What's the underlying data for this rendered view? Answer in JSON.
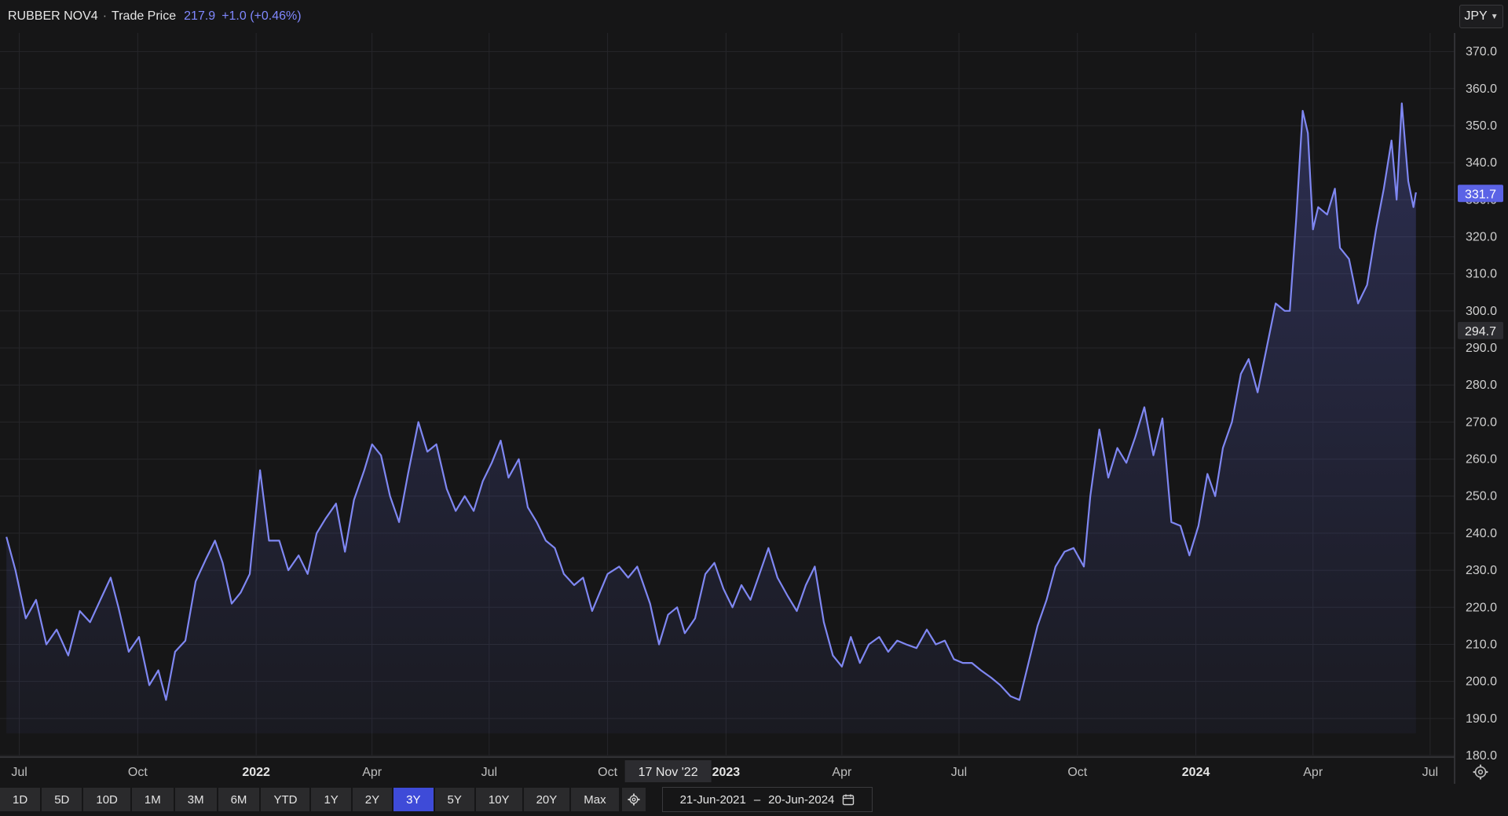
{
  "header": {
    "symbol": "RUBBER NOV4",
    "separator": "·",
    "price_label": "Trade Price",
    "price": "217.9",
    "change": "+1.0 (+0.46%)"
  },
  "currency": {
    "label": "JPY",
    "icon": "chevron-down-icon"
  },
  "range_buttons": [
    {
      "label": "1D"
    },
    {
      "label": "5D"
    },
    {
      "label": "10D"
    },
    {
      "label": "1M"
    },
    {
      "label": "3M"
    },
    {
      "label": "6M"
    },
    {
      "label": "YTD"
    },
    {
      "label": "1Y"
    },
    {
      "label": "2Y"
    },
    {
      "label": "3Y",
      "active": true
    },
    {
      "label": "5Y"
    },
    {
      "label": "10Y"
    },
    {
      "label": "20Y"
    },
    {
      "label": "Max"
    }
  ],
  "date_range": {
    "from": "21-Jun-2021",
    "dash": "–",
    "to": "20-Jun-2024",
    "icon": "calendar-icon"
  },
  "colors": {
    "background": "#161617",
    "line": "#7f87f2",
    "grid": "#26262a",
    "last_price_badge": "#5b63e6",
    "crosshair_badge": "#2c2c30"
  },
  "chart_data": {
    "type": "area",
    "series_name": "",
    "x_range": [
      "2021-06-21",
      "2024-06-20"
    ],
    "y_range": [
      180,
      375
    ],
    "y_ticks": [
      180,
      190,
      200,
      210,
      220,
      230,
      240,
      250,
      260,
      270,
      280,
      290,
      300,
      310,
      320,
      330,
      340,
      350,
      360,
      370
    ],
    "x_ticks": [
      {
        "date": "2021-07-01",
        "label": "Jul",
        "bold": false
      },
      {
        "date": "2021-10-01",
        "label": "Oct",
        "bold": false
      },
      {
        "date": "2022-01-01",
        "label": "2022",
        "bold": true
      },
      {
        "date": "2022-04-01",
        "label": "Apr",
        "bold": false
      },
      {
        "date": "2022-07-01",
        "label": "Jul",
        "bold": false
      },
      {
        "date": "2022-10-01",
        "label": "Oct",
        "bold": false
      },
      {
        "date": "2023-01-01",
        "label": "2023",
        "bold": true
      },
      {
        "date": "2023-04-01",
        "label": "Apr",
        "bold": false
      },
      {
        "date": "2023-07-01",
        "label": "Jul",
        "bold": false
      },
      {
        "date": "2023-10-01",
        "label": "Oct",
        "bold": false
      },
      {
        "date": "2024-01-01",
        "label": "2024",
        "bold": true
      },
      {
        "date": "2024-04-01",
        "label": "Apr",
        "bold": false
      },
      {
        "date": "2024-07-01",
        "label": "Jul",
        "bold": false
      }
    ],
    "grid": true,
    "last_price": {
      "value": 331.7,
      "label": "331.7"
    },
    "crosshair": {
      "value": 294.7,
      "label": "294.7",
      "date": "2022-11-17",
      "date_label": "17 Nov '22"
    },
    "points": [
      [
        "2021-06-21",
        239
      ],
      [
        "2021-06-28",
        230
      ],
      [
        "2021-07-06",
        217
      ],
      [
        "2021-07-14",
        222
      ],
      [
        "2021-07-22",
        210
      ],
      [
        "2021-07-30",
        214
      ],
      [
        "2021-08-08",
        207
      ],
      [
        "2021-08-17",
        219
      ],
      [
        "2021-08-25",
        216
      ],
      [
        "2021-09-02",
        222
      ],
      [
        "2021-09-10",
        228
      ],
      [
        "2021-09-16",
        220
      ],
      [
        "2021-09-24",
        208
      ],
      [
        "2021-10-02",
        212
      ],
      [
        "2021-10-10",
        199
      ],
      [
        "2021-10-17",
        203
      ],
      [
        "2021-10-23",
        195
      ],
      [
        "2021-10-30",
        208
      ],
      [
        "2021-11-07",
        211
      ],
      [
        "2021-11-15",
        227
      ],
      [
        "2021-11-23",
        233
      ],
      [
        "2021-11-30",
        238
      ],
      [
        "2021-12-06",
        232
      ],
      [
        "2021-12-13",
        221
      ],
      [
        "2021-12-20",
        224
      ],
      [
        "2021-12-27",
        229
      ],
      [
        "2022-01-04",
        257
      ],
      [
        "2022-01-11",
        238
      ],
      [
        "2022-01-19",
        238
      ],
      [
        "2022-01-26",
        230
      ],
      [
        "2022-02-03",
        234
      ],
      [
        "2022-02-10",
        229
      ],
      [
        "2022-02-17",
        240
      ],
      [
        "2022-02-24",
        244
      ],
      [
        "2022-03-04",
        248
      ],
      [
        "2022-03-11",
        235
      ],
      [
        "2022-03-18",
        249
      ],
      [
        "2022-03-26",
        257
      ],
      [
        "2022-04-01",
        264
      ],
      [
        "2022-04-08",
        261
      ],
      [
        "2022-04-15",
        250
      ],
      [
        "2022-04-22",
        243
      ],
      [
        "2022-04-29",
        256
      ],
      [
        "2022-05-07",
        270
      ],
      [
        "2022-05-14",
        262
      ],
      [
        "2022-05-21",
        264
      ],
      [
        "2022-05-29",
        252
      ],
      [
        "2022-06-05",
        246
      ],
      [
        "2022-06-12",
        250
      ],
      [
        "2022-06-19",
        246
      ],
      [
        "2022-06-26",
        254
      ],
      [
        "2022-07-03",
        259
      ],
      [
        "2022-07-10",
        265
      ],
      [
        "2022-07-16",
        255
      ],
      [
        "2022-07-24",
        260
      ],
      [
        "2022-07-31",
        247
      ],
      [
        "2022-08-07",
        243
      ],
      [
        "2022-08-14",
        238
      ],
      [
        "2022-08-21",
        236
      ],
      [
        "2022-08-28",
        229
      ],
      [
        "2022-09-05",
        226
      ],
      [
        "2022-09-12",
        228
      ],
      [
        "2022-09-19",
        219
      ],
      [
        "2022-09-25",
        224
      ],
      [
        "2022-10-01",
        229
      ],
      [
        "2022-10-10",
        231
      ],
      [
        "2022-10-17",
        228
      ],
      [
        "2022-10-24",
        231
      ],
      [
        "2022-11-03",
        221
      ],
      [
        "2022-11-10",
        210
      ],
      [
        "2022-11-17",
        218
      ],
      [
        "2022-11-24",
        220
      ],
      [
        "2022-11-30",
        213
      ],
      [
        "2022-12-08",
        217
      ],
      [
        "2022-12-16",
        229
      ],
      [
        "2022-12-23",
        232
      ],
      [
        "2022-12-30",
        225
      ],
      [
        "2023-01-06",
        220
      ],
      [
        "2023-01-13",
        226
      ],
      [
        "2023-01-20",
        222
      ],
      [
        "2023-01-27",
        229
      ],
      [
        "2023-02-03",
        236
      ],
      [
        "2023-02-10",
        228
      ],
      [
        "2023-02-18",
        223
      ],
      [
        "2023-02-25",
        219
      ],
      [
        "2023-03-04",
        226
      ],
      [
        "2023-03-11",
        231
      ],
      [
        "2023-03-18",
        216
      ],
      [
        "2023-03-25",
        207
      ],
      [
        "2023-04-01",
        204
      ],
      [
        "2023-04-08",
        212
      ],
      [
        "2023-04-15",
        205
      ],
      [
        "2023-04-22",
        210
      ],
      [
        "2023-04-30",
        212
      ],
      [
        "2023-05-07",
        208
      ],
      [
        "2023-05-14",
        211
      ],
      [
        "2023-05-21",
        210
      ],
      [
        "2023-05-29",
        209
      ],
      [
        "2023-06-06",
        214
      ],
      [
        "2023-06-13",
        210
      ],
      [
        "2023-06-20",
        211
      ],
      [
        "2023-06-27",
        206
      ],
      [
        "2023-07-04",
        205
      ],
      [
        "2023-07-11",
        205
      ],
      [
        "2023-07-18",
        203
      ],
      [
        "2023-07-26",
        201
      ],
      [
        "2023-08-02",
        199
      ],
      [
        "2023-08-10",
        196
      ],
      [
        "2023-08-17",
        195
      ],
      [
        "2023-08-24",
        205
      ],
      [
        "2023-08-31",
        215
      ],
      [
        "2023-09-07",
        222
      ],
      [
        "2023-09-14",
        231
      ],
      [
        "2023-09-21",
        235
      ],
      [
        "2023-09-28",
        236
      ],
      [
        "2023-10-06",
        231
      ],
      [
        "2023-10-11",
        250
      ],
      [
        "2023-10-18",
        268
      ],
      [
        "2023-10-25",
        255
      ],
      [
        "2023-11-01",
        263
      ],
      [
        "2023-11-08",
        259
      ],
      [
        "2023-11-15",
        266
      ],
      [
        "2023-11-22",
        274
      ],
      [
        "2023-11-29",
        261
      ],
      [
        "2023-12-06",
        271
      ],
      [
        "2023-12-13",
        243
      ],
      [
        "2023-12-20",
        242
      ],
      [
        "2023-12-27",
        234
      ],
      [
        "2024-01-03",
        242
      ],
      [
        "2024-01-10",
        256
      ],
      [
        "2024-01-16",
        250
      ],
      [
        "2024-01-22",
        263
      ],
      [
        "2024-01-29",
        270
      ],
      [
        "2024-02-05",
        283
      ],
      [
        "2024-02-11",
        287
      ],
      [
        "2024-02-18",
        278
      ],
      [
        "2024-02-25",
        290
      ],
      [
        "2024-03-03",
        302
      ],
      [
        "2024-03-10",
        300
      ],
      [
        "2024-03-14",
        300
      ],
      [
        "2024-03-19",
        325
      ],
      [
        "2024-03-24",
        354
      ],
      [
        "2024-03-28",
        348
      ],
      [
        "2024-04-01",
        322
      ],
      [
        "2024-04-05",
        328
      ],
      [
        "2024-04-12",
        326
      ],
      [
        "2024-04-18",
        333
      ],
      [
        "2024-04-22",
        317
      ],
      [
        "2024-04-29",
        314
      ],
      [
        "2024-05-06",
        302
      ],
      [
        "2024-05-13",
        307
      ],
      [
        "2024-05-20",
        322
      ],
      [
        "2024-05-26",
        333
      ],
      [
        "2024-06-01",
        346
      ],
      [
        "2024-06-05",
        330
      ],
      [
        "2024-06-09",
        356
      ],
      [
        "2024-06-14",
        335
      ],
      [
        "2024-06-18",
        328
      ],
      [
        "2024-06-20",
        332
      ]
    ]
  }
}
